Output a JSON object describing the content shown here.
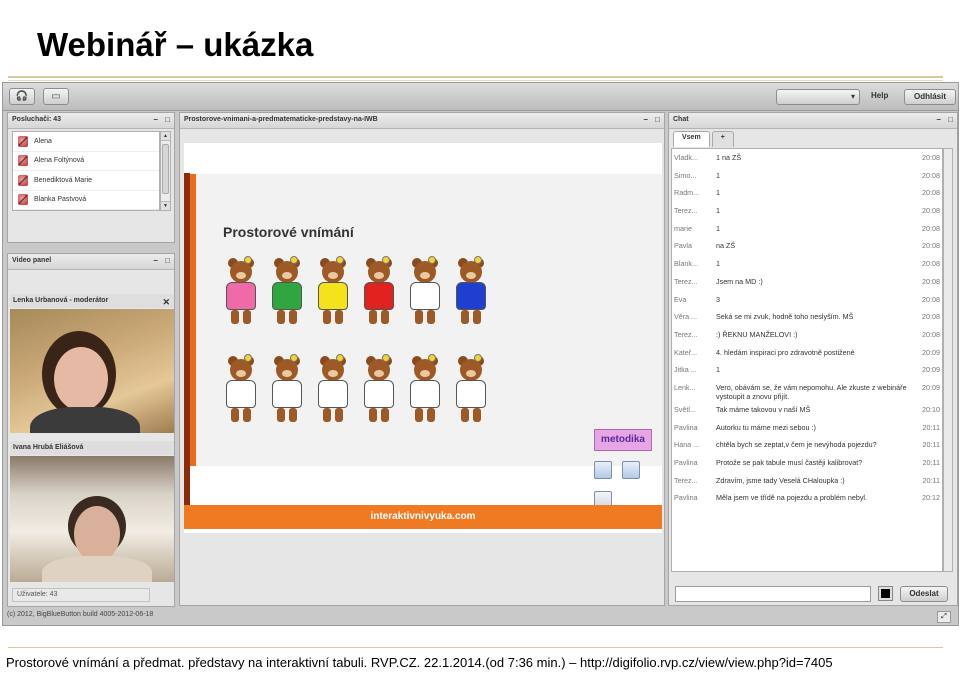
{
  "slide": {
    "title": "Webinář – ukázka",
    "caption": "Prostorové vnímání a předmat. představy na interaktivní tabuli. RVP.CZ. 22.1.2014.(od 7:36 min.) – http://digifolio.rvp.cz/view/view.php?id=7405"
  },
  "topbar": {
    "help": "Help",
    "logout": "Odhlásit"
  },
  "listeners": {
    "title": "Posluchači: 43",
    "items": [
      "Alena",
      "Alena Foltýnová",
      "Benediktová Marie",
      "Blanka Pastvová"
    ]
  },
  "video": {
    "title": "Video panel",
    "feeds": [
      "Lenka Urbanová - moderátor",
      "Ivana Hrubá Eliášová"
    ],
    "users": "Uživatele: 43"
  },
  "presentation": {
    "title": "Prostorove-vnimani-a-predmatematicke-predstavy-na-IWB",
    "slide_title": "Prostorové vnímání",
    "footer": "interaktivnivyuka.com",
    "metodika": "metodika",
    "bear_colors_top": [
      "#f06aa8",
      "#2fa640",
      "#f4e21a",
      "#e2221e",
      "#ffffff",
      "#1f3fd0"
    ],
    "bear_colors_bottom": [
      "#ffffff",
      "#ffffff",
      "#ffffff",
      "#ffffff",
      "#ffffff",
      "#ffffff"
    ]
  },
  "chat": {
    "title": "Chat",
    "tabs": [
      "Vsem",
      "+"
    ],
    "messages": [
      {
        "name": "Vladk...",
        "msg": "1 na ZŠ",
        "time": "20:08"
      },
      {
        "name": "Simo...",
        "msg": "1",
        "time": "20:08"
      },
      {
        "name": "Radm...",
        "msg": "1",
        "time": "20:08"
      },
      {
        "name": "Terez...",
        "msg": "1",
        "time": "20:08"
      },
      {
        "name": "marie",
        "msg": "1",
        "time": "20:08"
      },
      {
        "name": "Pavla",
        "msg": "na ZŠ",
        "time": "20:08"
      },
      {
        "name": "Blank...",
        "msg": "1",
        "time": "20:08"
      },
      {
        "name": "Terez...",
        "msg": "Jsem na MD :)",
        "time": "20:08"
      },
      {
        "name": "Eva",
        "msg": "3",
        "time": "20:08"
      },
      {
        "name": "Věra ...",
        "msg": "Seká se mi zvuk, hodně toho neslyším. MŠ",
        "time": "20:08"
      },
      {
        "name": "Terez...",
        "msg": ":) ŘEKNU MANŽELOVI :)",
        "time": "20:08"
      },
      {
        "name": "Kateř...",
        "msg": "4. hledám inspiraci pro zdravotně postižené",
        "time": "20:09"
      },
      {
        "name": "Jitka ...",
        "msg": "1",
        "time": "20:09"
      },
      {
        "name": "Lenk...",
        "msg": "Vero, obávám se, že vám nepomohu. Ale zkuste z webináře vystoupit a znovu přijít.",
        "time": "20:09"
      },
      {
        "name": "Světl...",
        "msg": "Tak máme takovou v naší MŠ",
        "time": "20:10"
      },
      {
        "name": "Pavlina",
        "msg": "Autorku tu máme mezi sebou :)",
        "time": "20:11"
      },
      {
        "name": "Hana ...",
        "msg": "chtěla bych se zeptat,v čem je nevýhoda pojezdu?",
        "time": "20:11"
      },
      {
        "name": "Pavlina",
        "msg": "Protože se pak tabule musí častěji kalibrovat?",
        "time": "20:11"
      },
      {
        "name": "Terez...",
        "msg": "Zdravím, jsme tady Veselá CHaloupka :)",
        "time": "20:11"
      },
      {
        "name": "Pavlina",
        "msg": "Měla jsem ve třídě na pojezdu a problém nebyl.",
        "time": "20:12"
      }
    ],
    "send": "Odeslat"
  },
  "status": {
    "text": "(c) 2012, BigBlueButton build 4005-2012-06-18"
  }
}
